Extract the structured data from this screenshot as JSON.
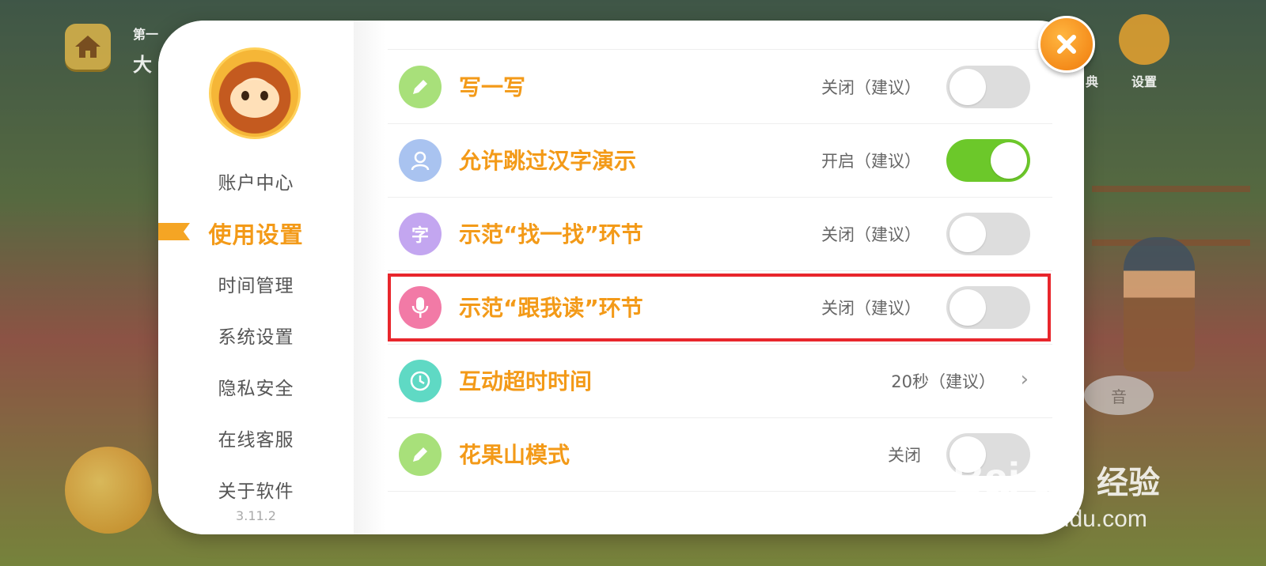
{
  "background": {
    "top_right_label": "设置",
    "top_right_label_partial": "典",
    "top_left_text_partial_1": "第一",
    "top_left_text_partial_2": "大"
  },
  "sidebar": {
    "items": [
      {
        "label": "账户中心",
        "active": false
      },
      {
        "label": "使用设置",
        "active": true
      },
      {
        "label": "时间管理",
        "active": false
      },
      {
        "label": "系统设置",
        "active": false
      },
      {
        "label": "隐私安全",
        "active": false
      },
      {
        "label": "在线客服",
        "active": false
      },
      {
        "label": "关于软件",
        "active": false
      }
    ],
    "version": "3.11.2"
  },
  "settings": {
    "rows": [
      {
        "icon": "pencil-icon",
        "icon_color": "#a8e07a",
        "title": "写一写",
        "status": "关闭（建议）",
        "toggle": false
      },
      {
        "icon": "person-icon",
        "icon_color": "#a9c3f0",
        "title": "允许跳过汉字演示",
        "status": "开启（建议）",
        "toggle": true
      },
      {
        "icon": "character-icon",
        "icon_glyph": "字",
        "icon_color": "#c3a6f0",
        "title": "示范“找一找”环节",
        "status": "关闭（建议）",
        "toggle": false
      },
      {
        "icon": "microphone-icon",
        "icon_color": "#f27aa6",
        "title": "示范“跟我读”环节",
        "status": "关闭（建议）",
        "toggle": false
      },
      {
        "icon": "clock-icon",
        "icon_color": "#5fd9c4",
        "title": "互动超时时间",
        "status": "20秒（建议）"
      },
      {
        "icon": "pencil-icon",
        "icon_color": "#a8e07a",
        "title": "花果山模式",
        "status": "关闭",
        "toggle": false
      }
    ]
  },
  "colors": {
    "accent": "#f39a18",
    "toggle_on": "#6cc82a",
    "highlight": "#e8262c"
  },
  "watermark": {
    "logo": "Bai du",
    "text": "经验",
    "url": "jingyan.baidu.com"
  }
}
